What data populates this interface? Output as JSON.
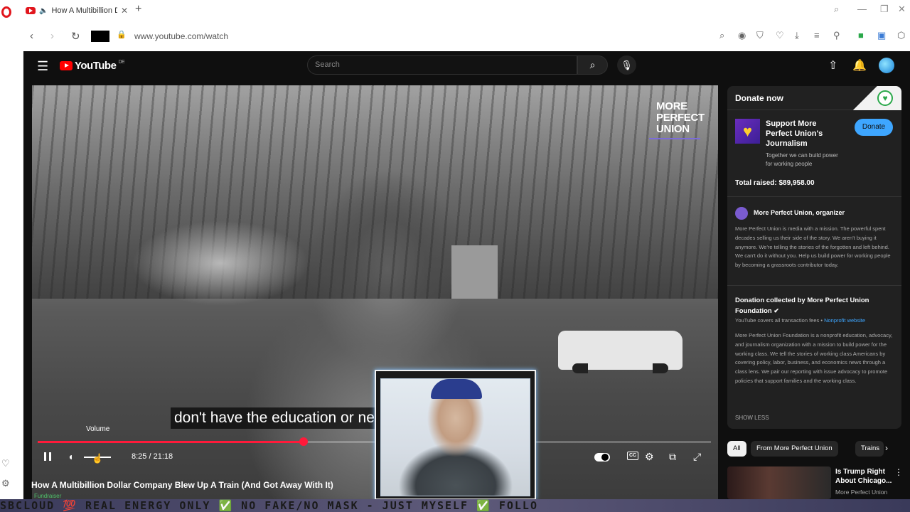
{
  "browser": {
    "tab_title": "How A Multibillion Do",
    "new_tab": "+",
    "url": "www.youtube.com/watch"
  },
  "youtube": {
    "logo_text": "YouTube",
    "region": "DE",
    "search_placeholder": "Search"
  },
  "video": {
    "brand_overlay": [
      "MORE",
      "PERFECT",
      "UNION"
    ],
    "caption": "don't have the education or            need",
    "volume_tooltip": "Volume",
    "current_time": "8:25",
    "duration": "21:18",
    "time_display": "8:25 / 21:18",
    "progress_fraction": 0.395,
    "title": "How A Multibillion Dollar Company Blew Up A Train (And Got Away With It)",
    "fundraiser_label": "Fundraiser"
  },
  "donation_panel": {
    "heading": "Donate now",
    "support_title": "Support More Perfect Union's Journalism",
    "support_subtitle": "Together we can build power for working people",
    "donate_button": "Donate",
    "total_raised": "Total raised: $89,958.00",
    "organizer": "More Perfect Union, organizer",
    "organizer_description": "More Perfect Union is media with a mission. The powerful spent decades selling us their side of the story. We aren't buying it anymore. We're telling the stories of the forgotten and left behind. We can't do it without you. Help us build power for working people by becoming a grassroots contributor today.",
    "collected_by": "Donation collected by More Perfect Union Foundation",
    "fees_note": "YouTube covers all transaction fees",
    "nonprofit_link": "Nonprofit website",
    "foundation_description": "More Perfect Union Foundation is a nonprofit education, advocacy, and journalism organization with a mission to build power for the working class. We tell the stories of working class Americans by covering policy, labor, business, and economics news through a class lens. We pair our reporting with issue advocacy to promote policies that support families and the working class.",
    "show_less": "SHOW LESS"
  },
  "chips": [
    "All",
    "From More Perfect Union",
    "Trains"
  ],
  "recommendation": {
    "title": "Is Trump Right About Chicago...",
    "channel": "More Perfect Union"
  },
  "ticker": "SBCLOUD 💯 REAL ENERGY ONLY ✅ NO FAKE/NO MASK - JUST MYSELF ✅ FOLLO",
  "colors": {
    "youtube_bg": "#0f0f0f",
    "progress": "#ff1a3a",
    "donate_button": "#3ea6ff",
    "panel_bg": "#212121"
  }
}
